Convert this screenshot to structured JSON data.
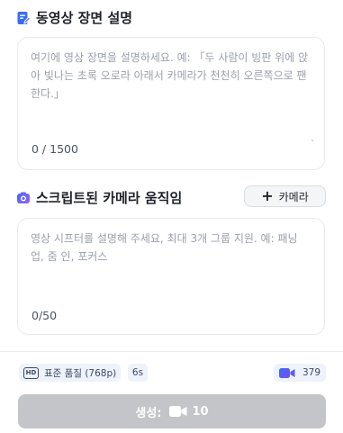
{
  "description_section": {
    "title": "동영상 장면 설명",
    "placeholder": "여기에 영상 장면을 설명하세요. 예: 「두 사람이 빙판 위에 앉아 빛나는 초록 오로라 아래서 카메라가 천천히 오른쪽으로 팬한다.」",
    "counter": "0 / 1500"
  },
  "camera_section": {
    "title": "스크립트된 카메라 움직임",
    "add_camera_label": "카메라",
    "placeholder": "영상 시프터를 설명해 주세요, 최대 3개 그룹 지원. 예: 패닝 업, 줌 인, 포커스",
    "counter": "0/50"
  },
  "footer": {
    "quality_badge": "HD",
    "quality_label": "표준 품질 (768p)",
    "duration": "6s",
    "credits": "379",
    "generate_label": "생성:",
    "generate_cost": "10"
  },
  "colors": {
    "accent": "#3b6cf6",
    "disabled_button": "#c4c5c8"
  },
  "icons": {
    "description": "edit-document-icon",
    "camera": "camera-icon",
    "credits": "video-icon"
  }
}
